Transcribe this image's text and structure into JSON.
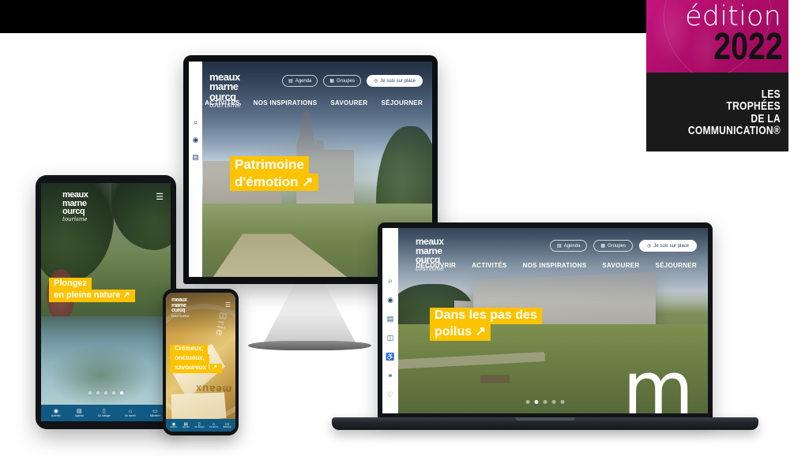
{
  "background": {
    "band_color": "#000000",
    "page_color": "#ffffff"
  },
  "award_badge": {
    "edition_label": "édition",
    "year": "2022",
    "line1": "LES",
    "line2": "TROPHÉES",
    "line3": "DE LA",
    "line4": "COMMUNICATION®",
    "top_color": "#b6106f",
    "bottom_color": "#1a1a1a"
  },
  "brand": {
    "line1": "meaux",
    "line2": "marne",
    "line3": "ourcq",
    "tagline": "tourisme"
  },
  "site": {
    "accent_color": "#FDC300",
    "bottom_bar_color": "#115a83",
    "header_buttons": [
      {
        "label": "Agenda",
        "icon": "calendar-icon",
        "style": "outline"
      },
      {
        "label": "Groupes",
        "icon": "groups-icon",
        "style": "outline"
      },
      {
        "label": "Je suis sur place",
        "icon": "location-pin-icon",
        "style": "solid"
      }
    ],
    "nav": [
      {
        "label": "DÉCOUVRIR"
      },
      {
        "label": "ACTIVITÉS"
      },
      {
        "label": "NOS INSPIRATIONS"
      },
      {
        "label": "SAVOURER"
      },
      {
        "label": "SÉJOURNER"
      }
    ],
    "side_rail_icons": [
      "search-icon",
      "location-target-icon",
      "calendar-icon",
      "brochure-icon",
      "accessibility-icon",
      "binoculars-icon",
      "favorite-heart-icon"
    ],
    "mobile_bar": [
      {
        "label": "Activités",
        "icon": "location-pin-icon"
      },
      {
        "label": "Agenda",
        "icon": "calendar-icon"
      },
      {
        "label": "Où manger",
        "icon": "restaurant-icon"
      },
      {
        "label": "Où dormir",
        "icon": "bed-icon"
      },
      {
        "label": "Billetterie",
        "icon": "ticket-icon"
      }
    ],
    "watermark": "m"
  },
  "devices": {
    "monitor": {
      "device_name": "desktop-monitor",
      "hero_line1": "Patrimoine",
      "hero_line2": "d'émotion",
      "hero_arrow": "↗",
      "photo_caption": "cathedral-and-gardens-photo"
    },
    "laptop": {
      "device_name": "laptop",
      "hero_line1": "Dans les pas des",
      "hero_line2": "poilus",
      "hero_arrow": "↗",
      "photo_caption": "great-war-museum-photo",
      "carousel": {
        "total": 5,
        "active": 2
      }
    },
    "tablet": {
      "device_name": "tablet",
      "hero_line1": "Plongez",
      "hero_line2": "en pleine nature",
      "hero_arrow": "↗",
      "photo_caption": "park-and-pond-photo",
      "carousel": {
        "total": 5,
        "active": 5
      }
    },
    "phone": {
      "device_name": "smartphone",
      "hero_line1": "Crémeux,",
      "hero_line2": "onctueux,",
      "hero_line3": "savoureux !",
      "hero_arrow": "↗",
      "photo_caption": "brie-de-meaux-cheese-photo",
      "menu_icon": "hamburger-menu-icon"
    }
  }
}
